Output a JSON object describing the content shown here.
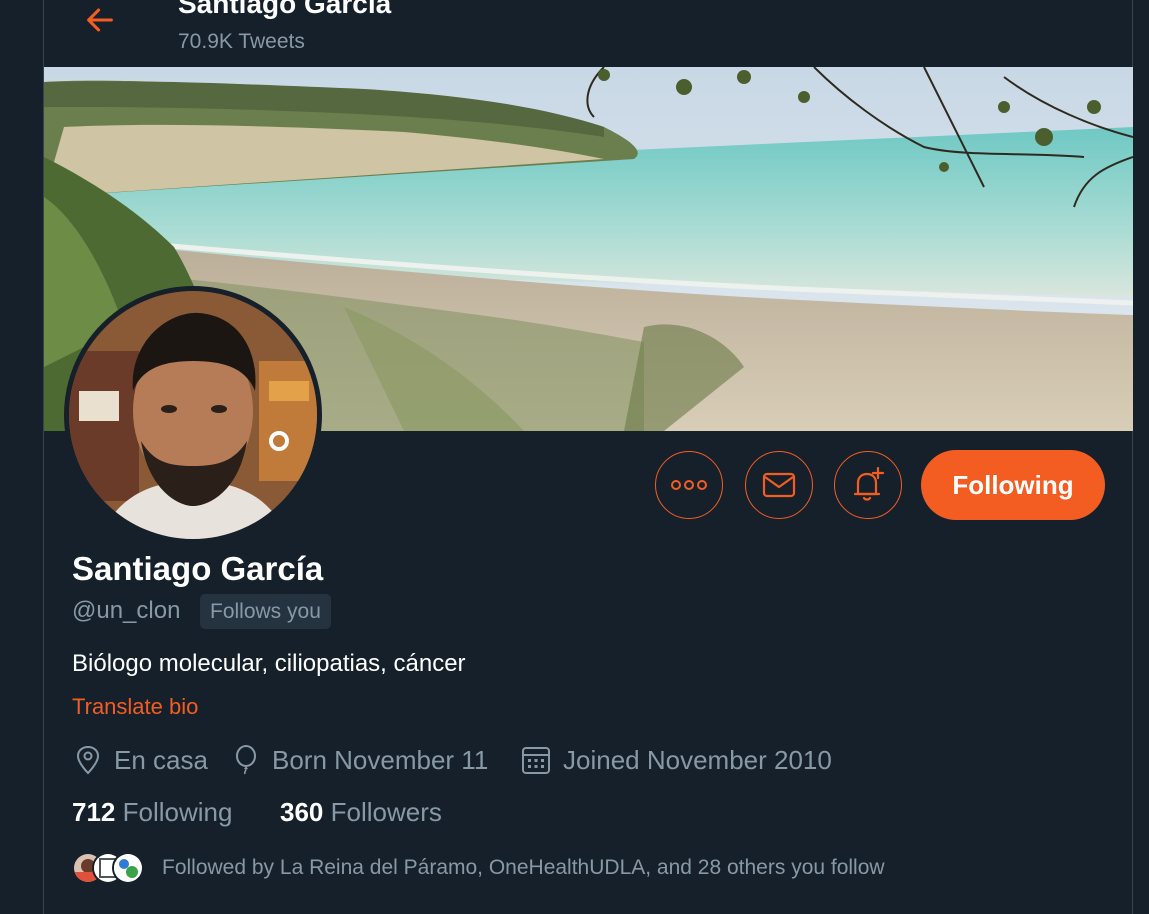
{
  "header": {
    "title": "Santiago García",
    "tweet_count": "70.9K Tweets"
  },
  "actions": {
    "more_icon": "more-icon",
    "message_icon": "envelope-icon",
    "notify_icon": "bell-plus-icon",
    "following_label": "Following"
  },
  "profile": {
    "name": "Santiago García",
    "handle": "@un_clon",
    "follows_you": "Follows you",
    "bio": "Biólogo molecular, ciliopatias, cáncer",
    "translate": "Translate bio",
    "location": "En casa",
    "birthday": "Born November 11",
    "joined": "Joined November 2010"
  },
  "stats": {
    "following_count": "712",
    "following_label": "Following",
    "followers_count": "360",
    "followers_label": "Followers"
  },
  "followed_by": "Followed by La Reina del Páramo, OneHealthUDLA, and 28 others you follow",
  "colors": {
    "background": "#15202b",
    "accent": "#f45d22",
    "secondary_text": "#8899a6"
  }
}
